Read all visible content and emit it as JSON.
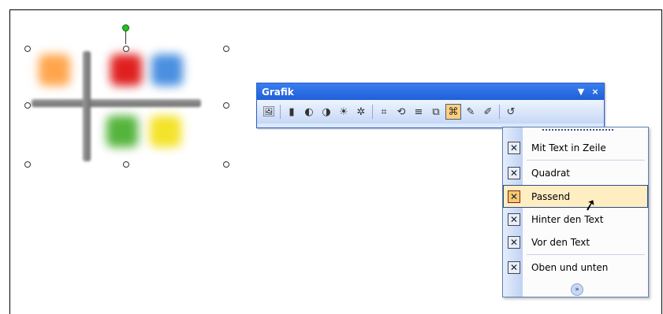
{
  "toolbar": {
    "title": "Grafik",
    "dropdown_icon": "chevron-down-icon",
    "close_symbol": "×",
    "buttons": [
      {
        "name": "insert-picture-icon",
        "glyph": "🖼"
      },
      {
        "name": "color-icon",
        "glyph": "▮"
      },
      {
        "name": "more-contrast-icon",
        "glyph": "◐"
      },
      {
        "name": "less-contrast-icon",
        "glyph": "◑"
      },
      {
        "name": "more-brightness-icon",
        "glyph": "☀"
      },
      {
        "name": "less-brightness-icon",
        "glyph": "✲"
      },
      {
        "name": "crop-icon",
        "glyph": "⌗"
      },
      {
        "name": "rotate-icon",
        "glyph": "⟲"
      },
      {
        "name": "line-style-icon",
        "glyph": "≡"
      },
      {
        "name": "compress-picture-icon",
        "glyph": "⧉"
      },
      {
        "name": "text-wrapping-icon",
        "glyph": "⌘"
      },
      {
        "name": "format-picture-icon",
        "glyph": "✎"
      },
      {
        "name": "set-transparent-color-icon",
        "glyph": "✐"
      },
      {
        "name": "reset-picture-icon",
        "glyph": "↺"
      }
    ]
  },
  "wrap_menu": {
    "items": [
      {
        "label": "Mit Text in Zeile",
        "icon": "inline-with-text-icon"
      },
      {
        "label": "Quadrat",
        "icon": "square-wrap-icon"
      },
      {
        "label": "Passend",
        "icon": "tight-wrap-icon"
      },
      {
        "label": "Hinter den Text",
        "icon": "behind-text-icon"
      },
      {
        "label": "Vor den Text",
        "icon": "in-front-of-text-icon"
      },
      {
        "label": "Oben und unten",
        "icon": "top-and-bottom-icon"
      }
    ],
    "highlighted_index": 2,
    "expand_icon": "expand-chevron-icon"
  },
  "colors": {
    "titlebar": "#2563d9",
    "highlight": "#ffeec2",
    "blob_orange": "#ffa64d",
    "blob_red": "#e02020",
    "blob_blue": "#4a8fe0",
    "blob_green": "#55b43c",
    "blob_yellow": "#f4e32a"
  }
}
